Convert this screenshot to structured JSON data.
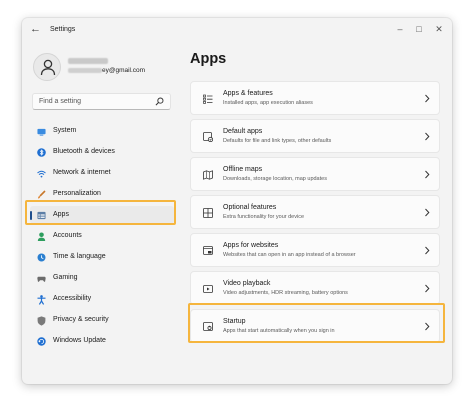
{
  "window": {
    "title": "Settings",
    "back_icon": "back-arrow-icon"
  },
  "profile": {
    "email_suffix": "ey@gmail.com"
  },
  "search": {
    "placeholder": "Find a setting"
  },
  "sidebar": {
    "items": [
      {
        "label": "System",
        "icon": "system-icon"
      },
      {
        "label": "Bluetooth & devices",
        "icon": "bluetooth-icon"
      },
      {
        "label": "Network & internet",
        "icon": "network-icon"
      },
      {
        "label": "Personalization",
        "icon": "brush-icon"
      },
      {
        "label": "Apps",
        "icon": "apps-icon",
        "selected": true
      },
      {
        "label": "Accounts",
        "icon": "accounts-icon"
      },
      {
        "label": "Time & language",
        "icon": "globe-clock-icon"
      },
      {
        "label": "Gaming",
        "icon": "gaming-icon"
      },
      {
        "label": "Accessibility",
        "icon": "accessibility-icon"
      },
      {
        "label": "Privacy & security",
        "icon": "shield-icon"
      },
      {
        "label": "Windows Update",
        "icon": "update-icon"
      }
    ]
  },
  "main": {
    "title": "Apps",
    "cards": [
      {
        "title": "Apps & features",
        "desc": "Installed apps, app execution aliases",
        "icon": "apps-list-icon"
      },
      {
        "title": "Default apps",
        "desc": "Defaults for file and link types, other defaults",
        "icon": "default-apps-icon"
      },
      {
        "title": "Offline maps",
        "desc": "Downloads, storage location, map updates",
        "icon": "map-icon"
      },
      {
        "title": "Optional features",
        "desc": "Extra functionality for your device",
        "icon": "optional-features-icon"
      },
      {
        "title": "Apps for websites",
        "desc": "Websites that can open in an app instead of a browser",
        "icon": "web-app-icon"
      },
      {
        "title": "Video playback",
        "desc": "Video adjustments, HDR streaming, battery options",
        "icon": "video-icon"
      },
      {
        "title": "Startup",
        "desc": "Apps that start automatically when you sign in",
        "icon": "startup-icon",
        "highlighted": true
      }
    ]
  },
  "colors": {
    "highlight": "#f5b53d",
    "accent": "#1f4e8c"
  }
}
